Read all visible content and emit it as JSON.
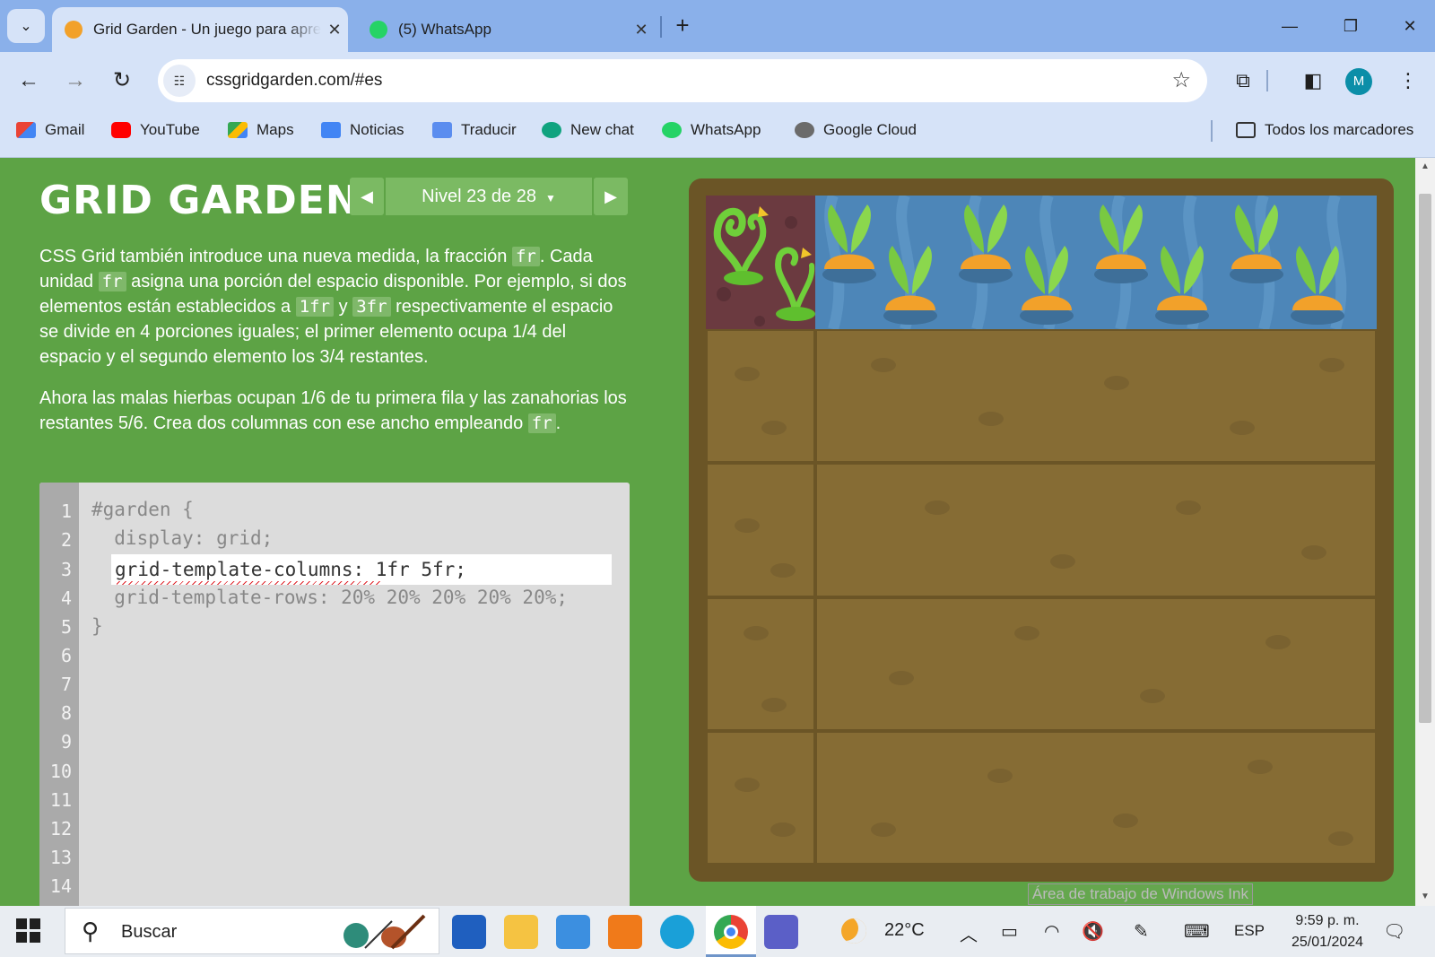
{
  "browser": {
    "tabs": [
      {
        "title": "Grid Garden - Un juego para aprender CSS grid",
        "active": true
      },
      {
        "title": "(5) WhatsApp",
        "active": false
      }
    ],
    "url": "cssgridgarden.com/#es",
    "profile_initial": "M",
    "bookmarks": [
      "Gmail",
      "YouTube",
      "Maps",
      "Noticias",
      "Traducir",
      "New chat",
      "WhatsApp",
      "Google Cloud"
    ],
    "all_bookmarks_label": "Todos los marcadores"
  },
  "game": {
    "logo": "GRID GARDEN",
    "level_label": "Nivel 23 de 28",
    "instructions": {
      "p1_a": "CSS Grid también introduce una nueva medida, la fracción ",
      "code_fr": "fr",
      "p1_b": ". Cada unidad ",
      "p1_c": " asigna una porción del espacio disponible. Por ejemplo, si dos elementos están establecidos a ",
      "code_1fr": "1fr",
      "p1_d": " y ",
      "code_3fr": "3fr",
      "p1_e": " respectivamente el espacio se divide en 4 porciones iguales; el primer elemento ocupa 1/4 del espacio y el segundo elemento los 3/4 restantes.",
      "p2_a": "Ahora las malas hierbas ocupan 1/6 de tu primera fila y las zanahorias los restantes 5/6. Crea dos columnas con ese ancho empleando ",
      "p2_b": "."
    },
    "editor": {
      "line_numbers": [
        "1",
        "2",
        "3",
        "4",
        "5",
        "6",
        "7",
        "8",
        "9",
        "10",
        "11",
        "12",
        "13",
        "14"
      ],
      "line1": "#garden {",
      "line2": "  display: grid;",
      "input_value": "grid-template-columns: 1fr 5fr;",
      "line4": "  grid-template-rows: 20% 20% 20% 20% 20%;",
      "line5": "}"
    }
  },
  "overlay": {
    "ink_tooltip": "Área de trabajo de Windows Ink"
  },
  "taskbar": {
    "search_placeholder": "Buscar",
    "temperature": "22°C",
    "language": "ESP",
    "time": "9:59 p. m.",
    "date": "25/01/2024"
  },
  "colors": {
    "page_bg": "#5da345",
    "soil": "#866c34",
    "water": "#4d86b8",
    "weeds_bg": "#6b3a40",
    "carrot": "#f2a12a"
  }
}
